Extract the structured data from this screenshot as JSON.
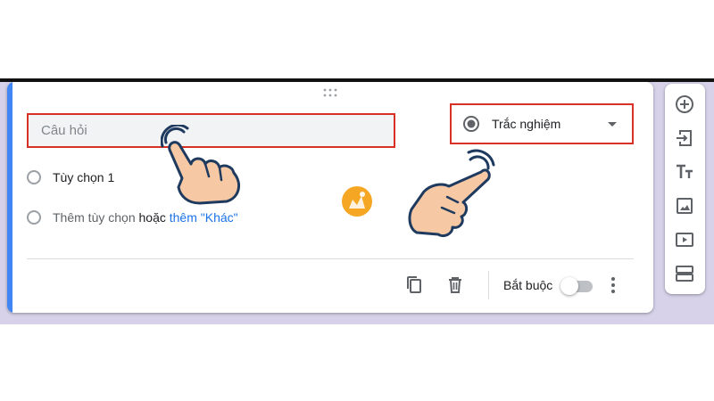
{
  "question": {
    "placeholder": "Câu hỏi"
  },
  "question_type": {
    "label": "Trắc nghiệm",
    "icon": "radio-button-checked-icon"
  },
  "options": [
    {
      "label": "Tùy chọn 1"
    }
  ],
  "add_option": {
    "label": "Thêm tùy chọn",
    "or_label": "hoặc",
    "other_label": "thêm \"Khác\""
  },
  "footer": {
    "duplicate_icon": "copy-icon",
    "delete_icon": "trash-icon",
    "required_label": "Bắt buộc",
    "required_on": false,
    "more_icon": "more-vert-icon"
  },
  "toolbar": [
    {
      "icon": "add-circle-icon"
    },
    {
      "icon": "import-icon"
    },
    {
      "icon": "title-text-icon"
    },
    {
      "icon": "image-icon"
    },
    {
      "icon": "video-icon"
    },
    {
      "icon": "section-icon"
    }
  ],
  "colors": {
    "accent": "#4285f4",
    "highlight": "#d93025",
    "link": "#1a73e8",
    "background": "#d7d2e9"
  }
}
